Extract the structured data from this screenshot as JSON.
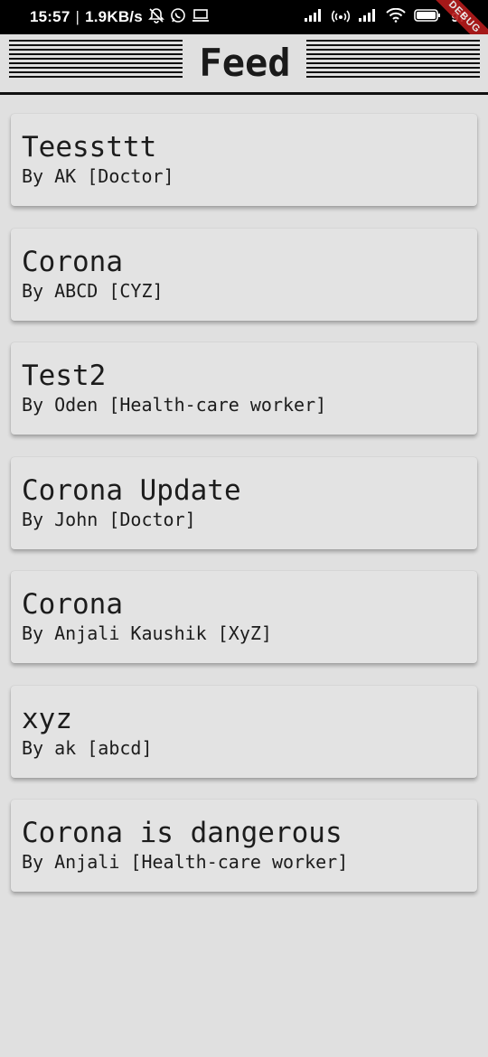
{
  "status_bar": {
    "time": "15:57",
    "separator": "|",
    "speed": "1.9KB/s",
    "battery_percent": "97",
    "icons": [
      "bell-off-icon",
      "whatsapp-icon",
      "laptop-icon",
      "signal-icon",
      "hotspot-icon",
      "signal-icon",
      "wifi-icon",
      "battery-icon"
    ]
  },
  "debug_banner": "DEBUG",
  "app_bar": {
    "title": "Feed"
  },
  "feed": [
    {
      "title": "Teessttt",
      "author": "By AK [Doctor]"
    },
    {
      "title": "Corona",
      "author": "By ABCD [CYZ]"
    },
    {
      "title": "Test2",
      "author": "By Oden [Health-care worker]"
    },
    {
      "title": "Corona Update",
      "author": "By John [Doctor]"
    },
    {
      "title": "Corona",
      "author": "By Anjali Kaushik [XyZ]"
    },
    {
      "title": "xyz",
      "author": "By ak [abcd]"
    },
    {
      "title": "Corona is dangerous",
      "author": "By Anjali [Health-care worker]"
    }
  ]
}
